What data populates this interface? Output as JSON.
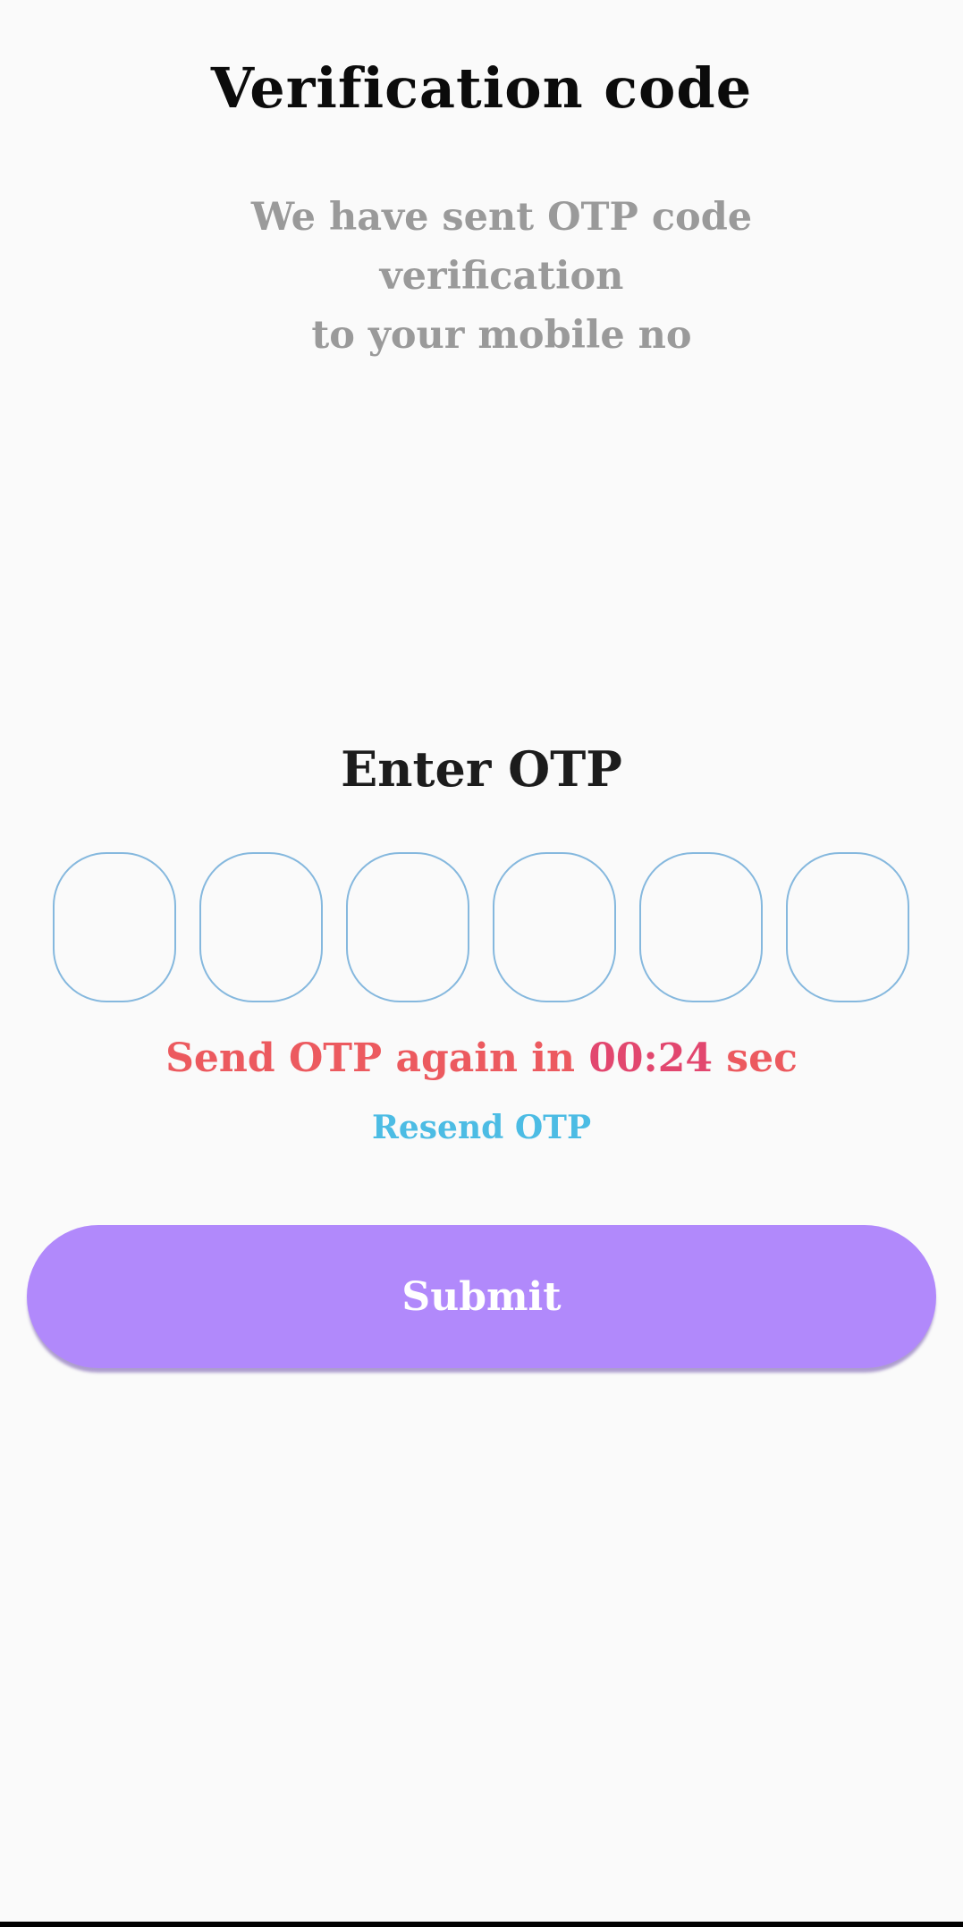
{
  "header": {
    "title": "Verification code",
    "subtitle_line1": "We have sent OTP code verification",
    "subtitle_line2": "to your mobile no"
  },
  "otp": {
    "heading": "Enter OTP",
    "digits": [
      "",
      "",
      "",
      "",
      "",
      ""
    ],
    "box_border_color": "#85b8de"
  },
  "timer": {
    "prefix": "Send OTP again in ",
    "time": "00:24",
    "suffix": " sec",
    "text_color": "#ec5a5f"
  },
  "resend": {
    "label": "Resend OTP",
    "color": "#4cbce4"
  },
  "submit": {
    "label": "Submit",
    "color": "#b189fb"
  }
}
